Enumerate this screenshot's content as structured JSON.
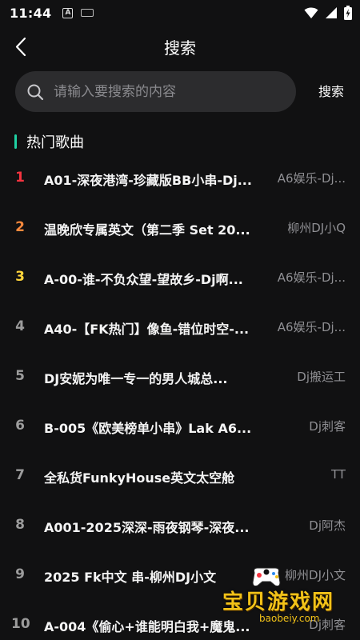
{
  "status_bar": {
    "time": "11:44",
    "a_label": "A"
  },
  "header": {
    "title": "搜索"
  },
  "search": {
    "placeholder": "请输入要搜索的内容",
    "value": "",
    "button_label": "搜索"
  },
  "section": {
    "title": "热门歌曲"
  },
  "songs": [
    {
      "rank": "1",
      "title": "A01-深夜港湾-珍藏版BB小串-Dj...",
      "artist": "A6娱乐-Dj..."
    },
    {
      "rank": "2",
      "title": "温晚欣专属英文（第二季 Set 20...",
      "artist": "柳州DJ小Q"
    },
    {
      "rank": "3",
      "title": "A-00-谁-不负众望-望故乡-Dj啊...",
      "artist": "A6娱乐-Dj..."
    },
    {
      "rank": "4",
      "title": "A40-【FK热门】像鱼-错位时空-...",
      "artist": "A6娱乐-Dj..."
    },
    {
      "rank": "5",
      "title": "DJ安妮为唯一专一的男人城总...",
      "artist": "Dj搬运工"
    },
    {
      "rank": "6",
      "title": "B-005《欧美榜单小串》Lak A6...",
      "artist": "Dj刺客"
    },
    {
      "rank": "7",
      "title": "全私货FunkyHouse英文太空舱",
      "artist": "TT"
    },
    {
      "rank": "8",
      "title": "A001-2025深深-雨夜钢琴-深夜...",
      "artist": "Dj阿杰"
    },
    {
      "rank": "9",
      "title": "2025 Fk中文 串-柳州DJ小文",
      "artist": "柳州DJ小文"
    },
    {
      "rank": "10",
      "title": "A-004《偷心+谁能明白我+魔鬼...",
      "artist": "Dj刺客"
    }
  ],
  "watermark": {
    "text": "宝贝游戏网",
    "url": "baobeiy.com"
  },
  "colors": {
    "background": "#111112",
    "accent": "#1fd1a3",
    "rank1": "#f5333f",
    "rank2": "#ff8a3d",
    "rank3": "#ffd43b"
  }
}
